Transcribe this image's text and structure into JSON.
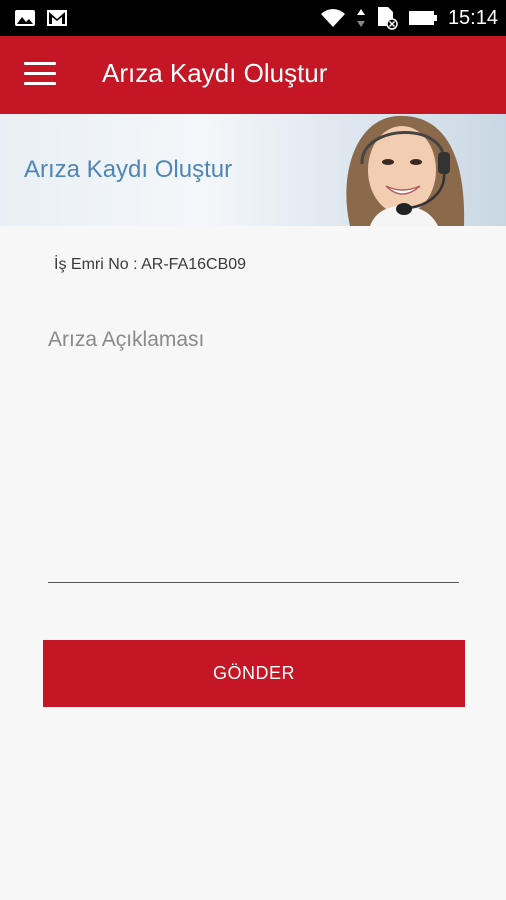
{
  "status_bar": {
    "time": "15:14",
    "left_icons": [
      "image-icon",
      "gmail-icon"
    ],
    "right_icons": [
      "wifi-icon",
      "sync-arrows-icon",
      "sim-card-icon",
      "battery-icon"
    ]
  },
  "app_bar": {
    "title": "Arıza Kaydı Oluştur",
    "menu_icon": "hamburger-menu-icon",
    "color": "#c41624"
  },
  "banner": {
    "title": "Arıza Kaydı Oluştur",
    "image": "support-agent-headset-photo"
  },
  "form": {
    "work_order_label": "İş Emri No : AR-FA16CB09",
    "description": {
      "value": "",
      "placeholder": "Arıza Açıklaması"
    },
    "submit_label": "GÖNDER"
  },
  "colors": {
    "accent": "#c41624",
    "background": "#f7f7f7",
    "banner_text": "#4f86b5"
  }
}
